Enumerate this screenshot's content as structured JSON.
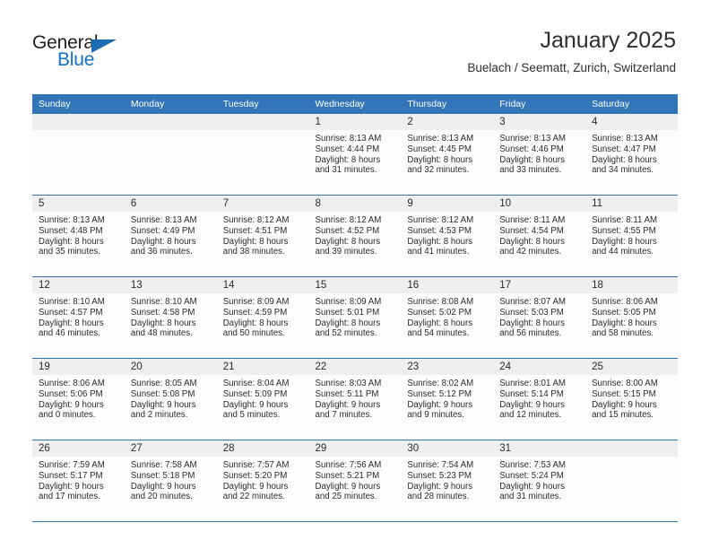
{
  "brand": {
    "name_part1": "General",
    "name_part2": "Blue",
    "accent_color": "#1273c4",
    "triangle_color": "#1b6cb0",
    "logo_icon": "triangle-flag-icon"
  },
  "header": {
    "title": "January 2025",
    "subtitle": "Buelach / Seematt, Zurich, Switzerland"
  },
  "theme": {
    "header_row_color": "#3276b8",
    "daynum_band_color": "#efefef",
    "row_separator_color": "#3276b8",
    "text_color": "#2b2b2b"
  },
  "weekdays": [
    "Sunday",
    "Monday",
    "Tuesday",
    "Wednesday",
    "Thursday",
    "Friday",
    "Saturday"
  ],
  "labels": {
    "sunrise_prefix": "Sunrise:",
    "sunset_prefix": "Sunset:",
    "daylight_prefix": "Daylight:"
  },
  "weeks": [
    [
      {
        "day": "",
        "blank": true,
        "sunrise": "",
        "sunset": "",
        "daylight_line1": "",
        "daylight_line2": ""
      },
      {
        "day": "",
        "blank": true,
        "sunrise": "",
        "sunset": "",
        "daylight_line1": "",
        "daylight_line2": ""
      },
      {
        "day": "",
        "blank": true,
        "sunrise": "",
        "sunset": "",
        "daylight_line1": "",
        "daylight_line2": ""
      },
      {
        "day": "1",
        "blank": false,
        "sunrise": "Sunrise: 8:13 AM",
        "sunset": "Sunset: 4:44 PM",
        "daylight_line1": "Daylight: 8 hours",
        "daylight_line2": "and 31 minutes."
      },
      {
        "day": "2",
        "blank": false,
        "sunrise": "Sunrise: 8:13 AM",
        "sunset": "Sunset: 4:45 PM",
        "daylight_line1": "Daylight: 8 hours",
        "daylight_line2": "and 32 minutes."
      },
      {
        "day": "3",
        "blank": false,
        "sunrise": "Sunrise: 8:13 AM",
        "sunset": "Sunset: 4:46 PM",
        "daylight_line1": "Daylight: 8 hours",
        "daylight_line2": "and 33 minutes."
      },
      {
        "day": "4",
        "blank": false,
        "sunrise": "Sunrise: 8:13 AM",
        "sunset": "Sunset: 4:47 PM",
        "daylight_line1": "Daylight: 8 hours",
        "daylight_line2": "and 34 minutes."
      }
    ],
    [
      {
        "day": "5",
        "blank": false,
        "sunrise": "Sunrise: 8:13 AM",
        "sunset": "Sunset: 4:48 PM",
        "daylight_line1": "Daylight: 8 hours",
        "daylight_line2": "and 35 minutes."
      },
      {
        "day": "6",
        "blank": false,
        "sunrise": "Sunrise: 8:13 AM",
        "sunset": "Sunset: 4:49 PM",
        "daylight_line1": "Daylight: 8 hours",
        "daylight_line2": "and 36 minutes."
      },
      {
        "day": "7",
        "blank": false,
        "sunrise": "Sunrise: 8:12 AM",
        "sunset": "Sunset: 4:51 PM",
        "daylight_line1": "Daylight: 8 hours",
        "daylight_line2": "and 38 minutes."
      },
      {
        "day": "8",
        "blank": false,
        "sunrise": "Sunrise: 8:12 AM",
        "sunset": "Sunset: 4:52 PM",
        "daylight_line1": "Daylight: 8 hours",
        "daylight_line2": "and 39 minutes."
      },
      {
        "day": "9",
        "blank": false,
        "sunrise": "Sunrise: 8:12 AM",
        "sunset": "Sunset: 4:53 PM",
        "daylight_line1": "Daylight: 8 hours",
        "daylight_line2": "and 41 minutes."
      },
      {
        "day": "10",
        "blank": false,
        "sunrise": "Sunrise: 8:11 AM",
        "sunset": "Sunset: 4:54 PM",
        "daylight_line1": "Daylight: 8 hours",
        "daylight_line2": "and 42 minutes."
      },
      {
        "day": "11",
        "blank": false,
        "sunrise": "Sunrise: 8:11 AM",
        "sunset": "Sunset: 4:55 PM",
        "daylight_line1": "Daylight: 8 hours",
        "daylight_line2": "and 44 minutes."
      }
    ],
    [
      {
        "day": "12",
        "blank": false,
        "sunrise": "Sunrise: 8:10 AM",
        "sunset": "Sunset: 4:57 PM",
        "daylight_line1": "Daylight: 8 hours",
        "daylight_line2": "and 46 minutes."
      },
      {
        "day": "13",
        "blank": false,
        "sunrise": "Sunrise: 8:10 AM",
        "sunset": "Sunset: 4:58 PM",
        "daylight_line1": "Daylight: 8 hours",
        "daylight_line2": "and 48 minutes."
      },
      {
        "day": "14",
        "blank": false,
        "sunrise": "Sunrise: 8:09 AM",
        "sunset": "Sunset: 4:59 PM",
        "daylight_line1": "Daylight: 8 hours",
        "daylight_line2": "and 50 minutes."
      },
      {
        "day": "15",
        "blank": false,
        "sunrise": "Sunrise: 8:09 AM",
        "sunset": "Sunset: 5:01 PM",
        "daylight_line1": "Daylight: 8 hours",
        "daylight_line2": "and 52 minutes."
      },
      {
        "day": "16",
        "blank": false,
        "sunrise": "Sunrise: 8:08 AM",
        "sunset": "Sunset: 5:02 PM",
        "daylight_line1": "Daylight: 8 hours",
        "daylight_line2": "and 54 minutes."
      },
      {
        "day": "17",
        "blank": false,
        "sunrise": "Sunrise: 8:07 AM",
        "sunset": "Sunset: 5:03 PM",
        "daylight_line1": "Daylight: 8 hours",
        "daylight_line2": "and 56 minutes."
      },
      {
        "day": "18",
        "blank": false,
        "sunrise": "Sunrise: 8:06 AM",
        "sunset": "Sunset: 5:05 PM",
        "daylight_line1": "Daylight: 8 hours",
        "daylight_line2": "and 58 minutes."
      }
    ],
    [
      {
        "day": "19",
        "blank": false,
        "sunrise": "Sunrise: 8:06 AM",
        "sunset": "Sunset: 5:06 PM",
        "daylight_line1": "Daylight: 9 hours",
        "daylight_line2": "and 0 minutes."
      },
      {
        "day": "20",
        "blank": false,
        "sunrise": "Sunrise: 8:05 AM",
        "sunset": "Sunset: 5:08 PM",
        "daylight_line1": "Daylight: 9 hours",
        "daylight_line2": "and 2 minutes."
      },
      {
        "day": "21",
        "blank": false,
        "sunrise": "Sunrise: 8:04 AM",
        "sunset": "Sunset: 5:09 PM",
        "daylight_line1": "Daylight: 9 hours",
        "daylight_line2": "and 5 minutes."
      },
      {
        "day": "22",
        "blank": false,
        "sunrise": "Sunrise: 8:03 AM",
        "sunset": "Sunset: 5:11 PM",
        "daylight_line1": "Daylight: 9 hours",
        "daylight_line2": "and 7 minutes."
      },
      {
        "day": "23",
        "blank": false,
        "sunrise": "Sunrise: 8:02 AM",
        "sunset": "Sunset: 5:12 PM",
        "daylight_line1": "Daylight: 9 hours",
        "daylight_line2": "and 9 minutes."
      },
      {
        "day": "24",
        "blank": false,
        "sunrise": "Sunrise: 8:01 AM",
        "sunset": "Sunset: 5:14 PM",
        "daylight_line1": "Daylight: 9 hours",
        "daylight_line2": "and 12 minutes."
      },
      {
        "day": "25",
        "blank": false,
        "sunrise": "Sunrise: 8:00 AM",
        "sunset": "Sunset: 5:15 PM",
        "daylight_line1": "Daylight: 9 hours",
        "daylight_line2": "and 15 minutes."
      }
    ],
    [
      {
        "day": "26",
        "blank": false,
        "sunrise": "Sunrise: 7:59 AM",
        "sunset": "Sunset: 5:17 PM",
        "daylight_line1": "Daylight: 9 hours",
        "daylight_line2": "and 17 minutes."
      },
      {
        "day": "27",
        "blank": false,
        "sunrise": "Sunrise: 7:58 AM",
        "sunset": "Sunset: 5:18 PM",
        "daylight_line1": "Daylight: 9 hours",
        "daylight_line2": "and 20 minutes."
      },
      {
        "day": "28",
        "blank": false,
        "sunrise": "Sunrise: 7:57 AM",
        "sunset": "Sunset: 5:20 PM",
        "daylight_line1": "Daylight: 9 hours",
        "daylight_line2": "and 22 minutes."
      },
      {
        "day": "29",
        "blank": false,
        "sunrise": "Sunrise: 7:56 AM",
        "sunset": "Sunset: 5:21 PM",
        "daylight_line1": "Daylight: 9 hours",
        "daylight_line2": "and 25 minutes."
      },
      {
        "day": "30",
        "blank": false,
        "sunrise": "Sunrise: 7:54 AM",
        "sunset": "Sunset: 5:23 PM",
        "daylight_line1": "Daylight: 9 hours",
        "daylight_line2": "and 28 minutes."
      },
      {
        "day": "31",
        "blank": false,
        "sunrise": "Sunrise: 7:53 AM",
        "sunset": "Sunset: 5:24 PM",
        "daylight_line1": "Daylight: 9 hours",
        "daylight_line2": "and 31 minutes."
      },
      {
        "day": "",
        "blank": true,
        "sunrise": "",
        "sunset": "",
        "daylight_line1": "",
        "daylight_line2": ""
      }
    ]
  ]
}
